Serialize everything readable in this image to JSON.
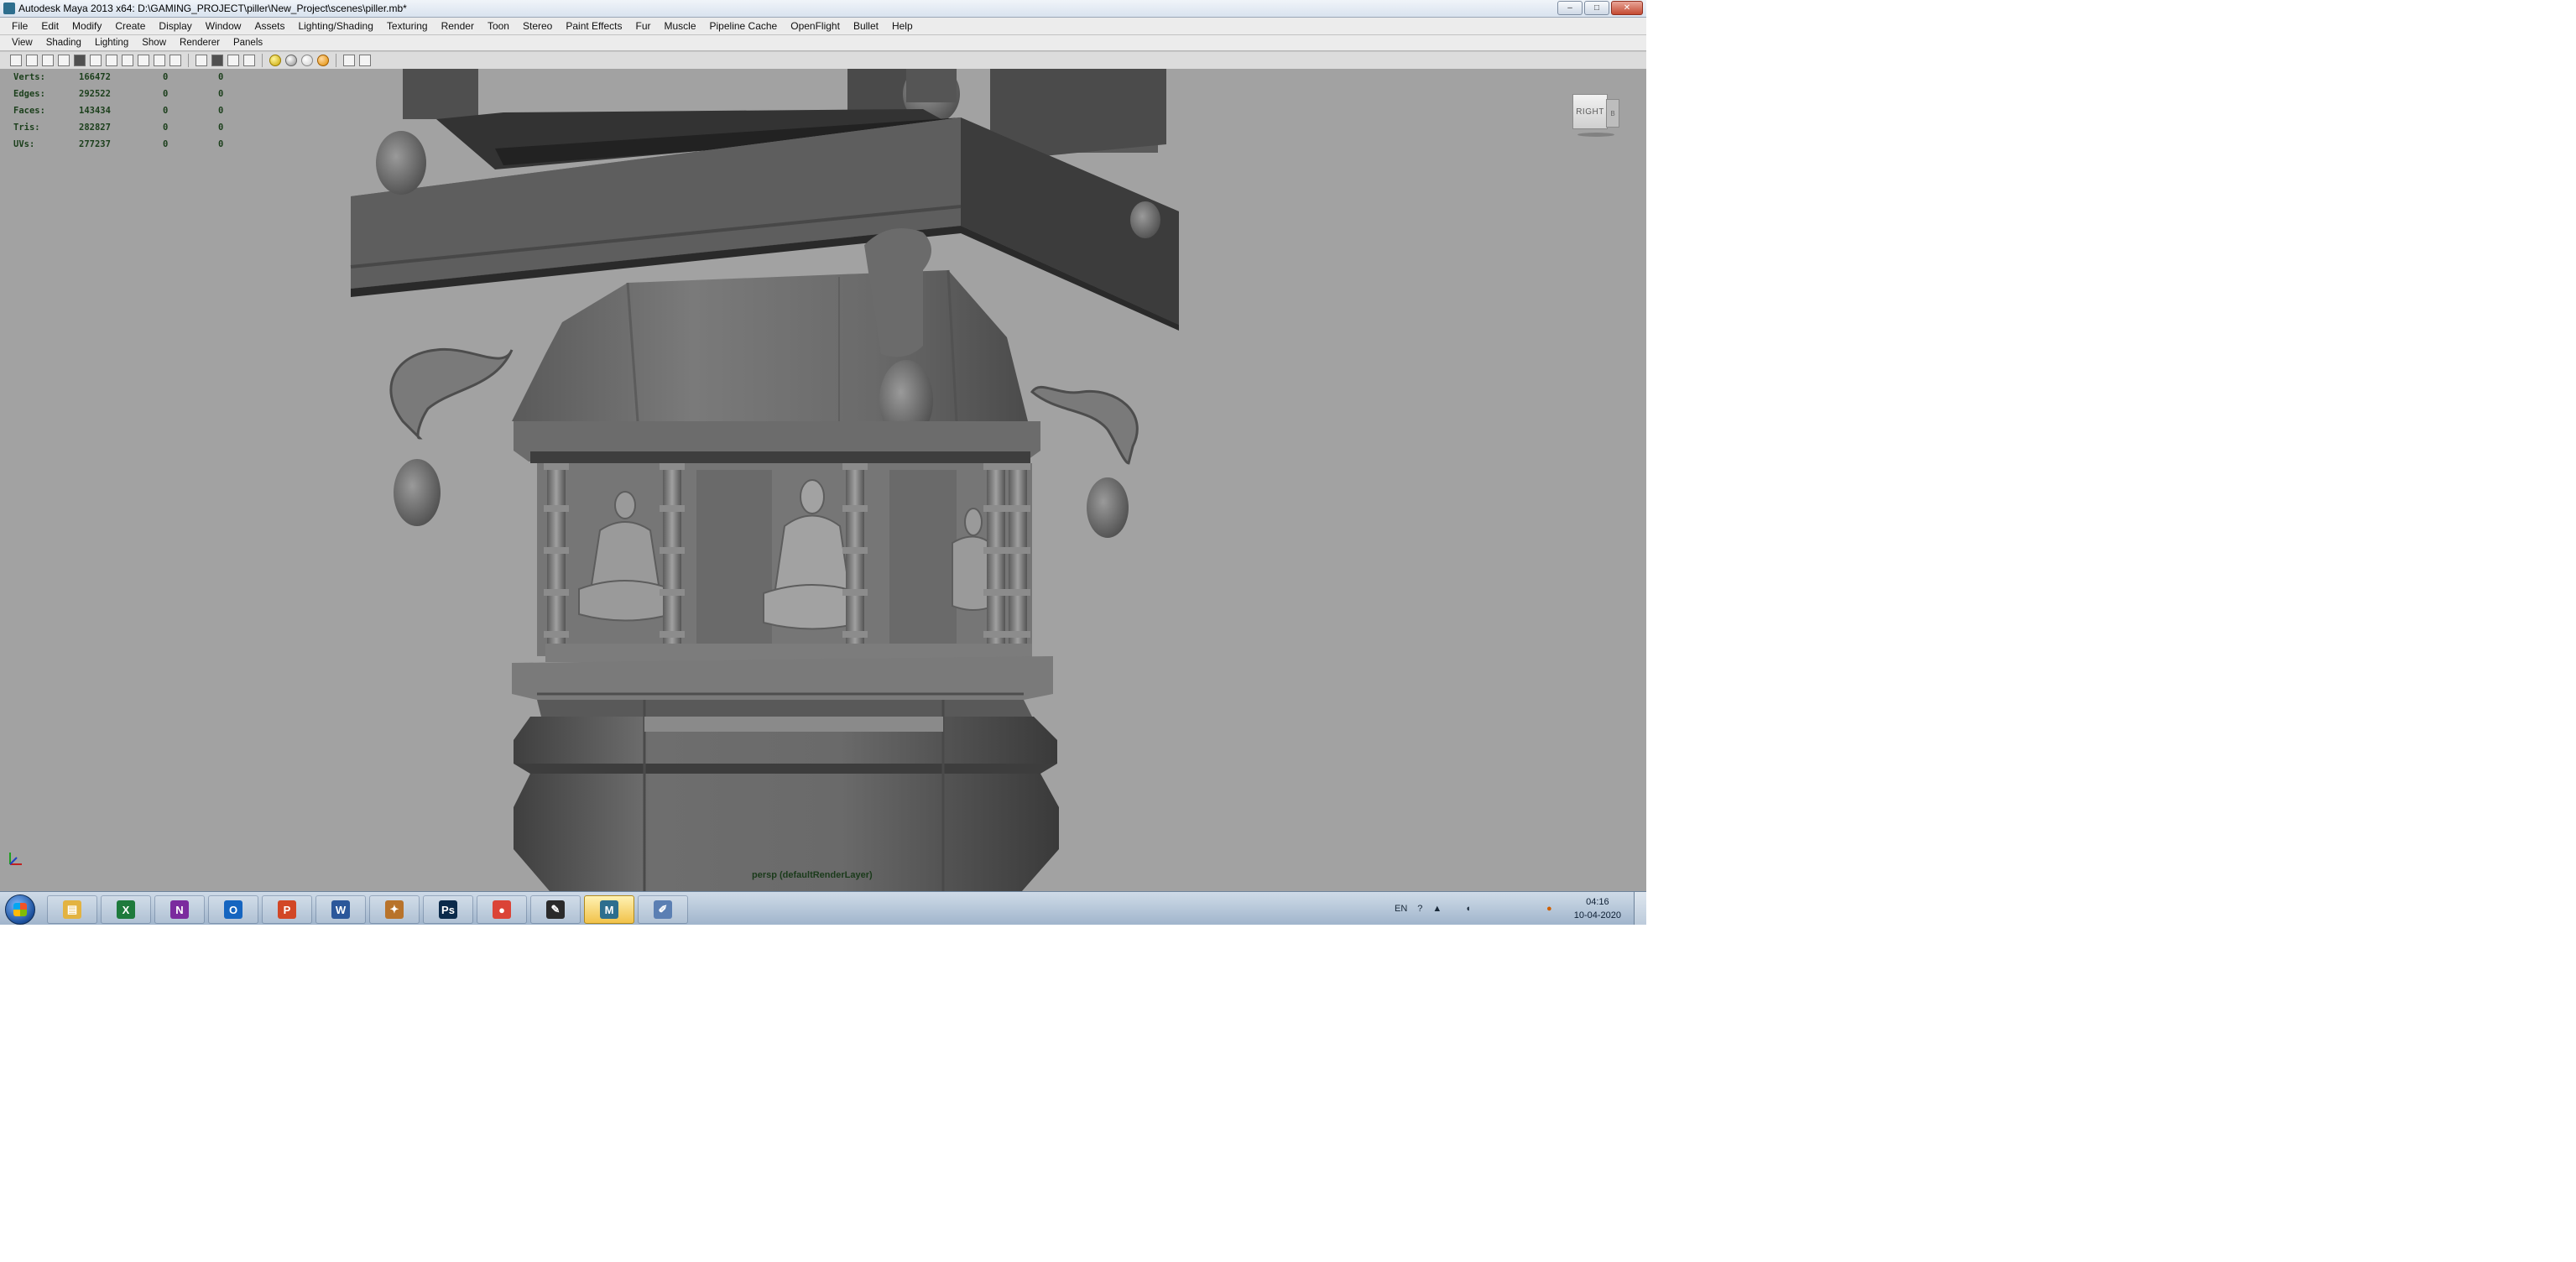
{
  "window": {
    "title": "Autodesk Maya 2013 x64: D:\\GAMING_PROJECT\\piller\\New_Project\\scenes\\piller.mb*",
    "minimize": "–",
    "maximize": "□",
    "close": "✕"
  },
  "main_menu": [
    "File",
    "Edit",
    "Modify",
    "Create",
    "Display",
    "Window",
    "Assets",
    "Lighting/Shading",
    "Texturing",
    "Render",
    "Toon",
    "Stereo",
    "Paint Effects",
    "Fur",
    "Muscle",
    "Pipeline Cache",
    "OpenFlight",
    "Bullet",
    "Help"
  ],
  "panel_menu": [
    "View",
    "Shading",
    "Lighting",
    "Show",
    "Renderer",
    "Panels"
  ],
  "toolbar_icons": [
    "camera-select-icon",
    "lock-camera-icon",
    "bookmarks-icon",
    "image-plane-icon",
    "grid-icon",
    "film-gate-icon",
    "resolution-gate-icon",
    "gate-mask-icon",
    "field-chart-icon",
    "safe-action-icon",
    "safe-title-icon",
    "wireframe-icon",
    "smooth-shade-icon",
    "wireframe-on-shaded-icon",
    "textured-icon",
    "use-all-lights-icon",
    "shadows-icon",
    "xray-icon",
    "xray-joints-icon",
    "isolate-select-icon",
    "high-quality-icon"
  ],
  "hud": {
    "rows": [
      {
        "label": "Verts:",
        "v1": "166472",
        "v2": "0",
        "v3": "0"
      },
      {
        "label": "Edges:",
        "v1": "292522",
        "v2": "0",
        "v3": "0"
      },
      {
        "label": "Faces:",
        "v1": "143434",
        "v2": "0",
        "v3": "0"
      },
      {
        "label": "Tris:",
        "v1": "282827",
        "v2": "0",
        "v3": "0"
      },
      {
        "label": "UVs:",
        "v1": "277237",
        "v2": "0",
        "v3": "0"
      }
    ]
  },
  "viewcube": {
    "face_label": "RIGHT",
    "side_label": "B"
  },
  "camera_label": "persp (defaultRenderLayer)",
  "taskbar": {
    "apps": [
      {
        "name": "explorer-icon",
        "glyph": "▤",
        "color": "#e3b341"
      },
      {
        "name": "excel-icon",
        "glyph": "X",
        "color": "#1e7a3c"
      },
      {
        "name": "onenote-icon",
        "glyph": "N",
        "color": "#7b2b9e"
      },
      {
        "name": "outlook-icon",
        "glyph": "O",
        "color": "#1565c0"
      },
      {
        "name": "powerpoint-icon",
        "glyph": "P",
        "color": "#d24726"
      },
      {
        "name": "word-icon",
        "glyph": "W",
        "color": "#2b579a"
      },
      {
        "name": "generic-app-icon",
        "glyph": "✦",
        "color": "#b8732b"
      },
      {
        "name": "photoshop-icon",
        "glyph": "Ps",
        "color": "#0b2a4a"
      },
      {
        "name": "chrome-icon",
        "glyph": "●",
        "color": "#db4437"
      },
      {
        "name": "tool-app-icon",
        "glyph": "✎",
        "color": "#2a2a2a"
      },
      {
        "name": "maya-icon",
        "glyph": "M",
        "color": "#2d6e8e"
      },
      {
        "name": "paint-icon",
        "glyph": "✐",
        "color": "#5b7fb3"
      }
    ],
    "active_index": 10,
    "language": "EN",
    "help_glyph": "?",
    "time": "04:16",
    "date": "10-04-2020"
  }
}
